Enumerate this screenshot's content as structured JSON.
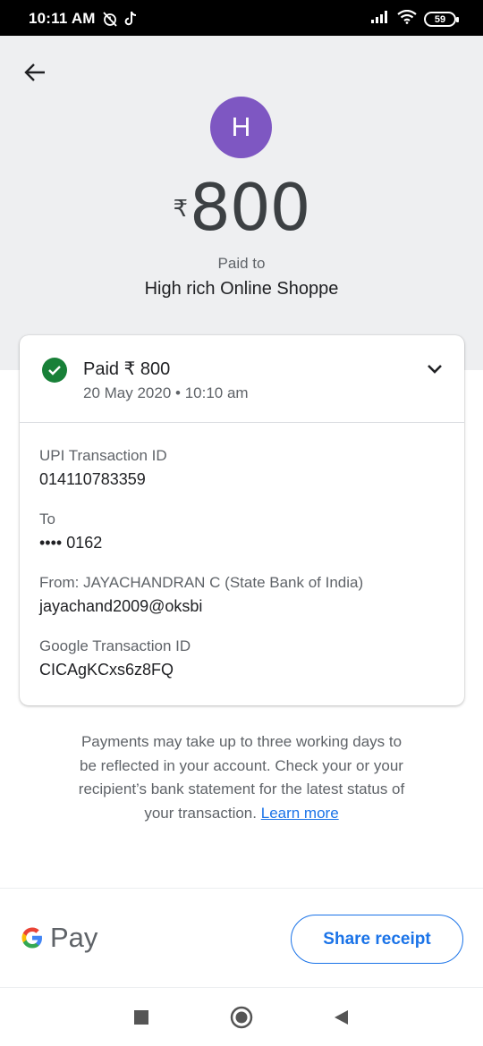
{
  "status_bar": {
    "time": "10:11 AM",
    "battery": "59",
    "icons": [
      "alarm-off-icon",
      "tiktok-icon",
      "signal-icon",
      "wifi-icon",
      "battery-icon"
    ]
  },
  "header": {
    "avatar_letter": "H",
    "currency_symbol": "₹",
    "amount": "800",
    "paid_to_label": "Paid to",
    "merchant_name": "High rich Online Shoppe"
  },
  "transaction": {
    "status_title": "Paid ₹ 800",
    "date_time": "20 May 2020 • 10:10 am",
    "details": [
      {
        "label": "UPI Transaction ID",
        "value": "014110783359"
      },
      {
        "label": "To",
        "value": "•••• 0162"
      },
      {
        "label": "From: JAYACHANDRAN  C (State Bank of India)",
        "value": "jayachand2009@oksbi"
      },
      {
        "label": "Google Transaction ID",
        "value": "CICAgKCxs6z8FQ"
      }
    ]
  },
  "info": {
    "text": "Payments may take up to three working days to be reflected in your account. Check your or your recipient’s bank statement for the latest status of your transaction.",
    "link_text": "Learn more"
  },
  "footer": {
    "brand_text": "Pay",
    "share_label": "Share receipt"
  },
  "colors": {
    "accent": "#1a73e8",
    "avatar": "#7e57c2",
    "success": "#188038",
    "header_bg": "#eeeff1"
  }
}
